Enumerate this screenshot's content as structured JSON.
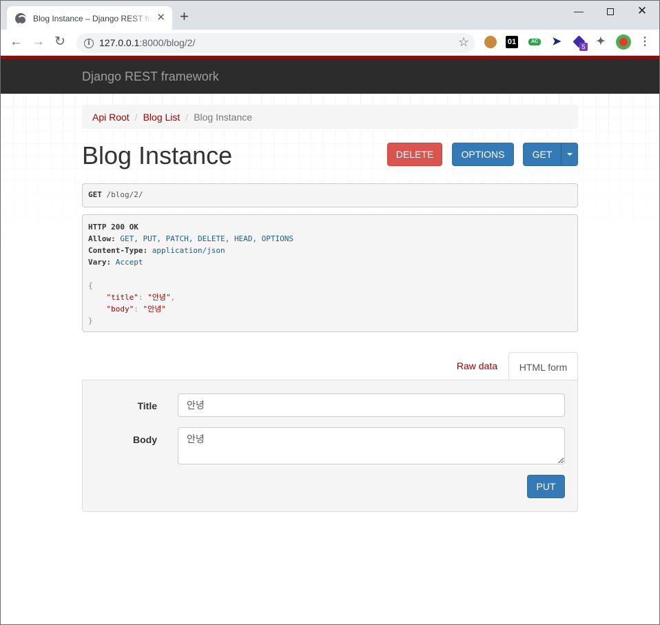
{
  "browser": {
    "tab_title": "Blog Instance – Django REST framework",
    "new_tab_icon": "plus-icon",
    "url_host": "127.0.0.1",
    "url_rest": ":8000/blog/2/",
    "extensions": [
      "cookie-icon",
      "01-extension-icon",
      "ac-extension-icon",
      "cursor-extension-icon",
      "cube-extension-icon",
      "puzzle-icon",
      "profile-avatar",
      "menu-icon"
    ],
    "ext_badge": "5",
    "colors": {
      "titlebar": "#dee1e6",
      "toolbar": "#ffffff"
    }
  },
  "navbar": {
    "brand": "Django REST framework",
    "colors": {
      "stripe": "#a30000",
      "bar": "#2c2c2c"
    }
  },
  "breadcrumb": {
    "items": [
      "Api Root",
      "Blog List",
      "Blog Instance"
    ],
    "separator": "/"
  },
  "page": {
    "title": "Blog Instance"
  },
  "actions": {
    "delete_label": "DELETE",
    "options_label": "OPTIONS",
    "get_label": "GET",
    "colors": {
      "danger": "#d9534f",
      "primary": "#337ab7"
    }
  },
  "request": {
    "method": "GET",
    "path": "/blog/2/"
  },
  "response": {
    "status_line": "HTTP 200 OK",
    "headers": [
      {
        "key": "Allow:",
        "value": "GET, PUT, PATCH, DELETE, HEAD, OPTIONS"
      },
      {
        "key": "Content-Type:",
        "value": "application/json"
      },
      {
        "key": "Vary:",
        "value": "Accept"
      }
    ],
    "json_open": "{",
    "json_close": "}",
    "fields": [
      {
        "key": "\"title\"",
        "sep": ": ",
        "value": "\"안녕\"",
        "trail": ","
      },
      {
        "key": "\"body\"",
        "sep": ": ",
        "value": "\"안녕\"",
        "trail": ""
      }
    ]
  },
  "form_tabs": {
    "raw_label": "Raw data",
    "html_label": "HTML form"
  },
  "form": {
    "title_label": "Title",
    "title_value": "안녕",
    "body_label": "Body",
    "body_value": "안녕",
    "submit_label": "PUT"
  }
}
